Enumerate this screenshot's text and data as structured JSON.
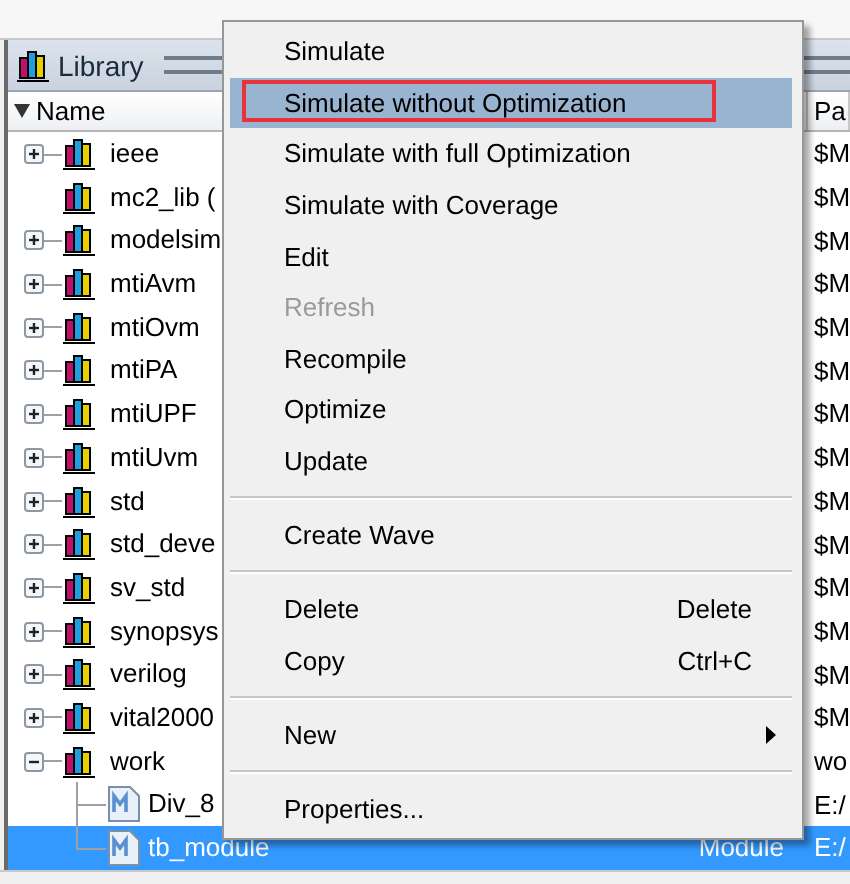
{
  "panel": {
    "title": "Library"
  },
  "columns": [
    {
      "label": "Name"
    },
    {
      "label": "Pa"
    }
  ],
  "libraries": [
    {
      "kind": "library",
      "name": "ieee",
      "expanded": false,
      "selected": false,
      "path": "$M"
    },
    {
      "kind": "library",
      "name": "mc2_lib (",
      "selected": false,
      "path": "$M"
    },
    {
      "kind": "library",
      "name": "modelsim",
      "expanded": false,
      "selected": false,
      "path": "$M"
    },
    {
      "kind": "library",
      "name": "mtiAvm",
      "expanded": false,
      "selected": false,
      "path": "$M"
    },
    {
      "kind": "library",
      "name": "mtiOvm",
      "expanded": false,
      "selected": false,
      "path": "$M"
    },
    {
      "kind": "library",
      "name": "mtiPA",
      "expanded": false,
      "selected": false,
      "path": "$M"
    },
    {
      "kind": "library",
      "name": "mtiUPF",
      "expanded": false,
      "selected": false,
      "path": "$M"
    },
    {
      "kind": "library",
      "name": "mtiUvm",
      "expanded": false,
      "selected": false,
      "path": "$M"
    },
    {
      "kind": "library",
      "name": "std",
      "expanded": false,
      "selected": false,
      "path": "$M"
    },
    {
      "kind": "library",
      "name": "std_deve",
      "expanded": false,
      "selected": false,
      "path": "$M"
    },
    {
      "kind": "library",
      "name": "sv_std",
      "expanded": false,
      "selected": false,
      "path": "$M"
    },
    {
      "kind": "library",
      "name": "synopsys",
      "expanded": false,
      "selected": false,
      "path": "$M"
    },
    {
      "kind": "library",
      "name": "verilog",
      "expanded": false,
      "selected": false,
      "path": "$M"
    },
    {
      "kind": "library",
      "name": "vital2000",
      "expanded": false,
      "selected": false,
      "path": "$M"
    },
    {
      "kind": "library",
      "name": "work",
      "expanded": true,
      "selected": false,
      "path": "wo",
      "children": [
        {
          "kind": "module",
          "name": "Div_8",
          "selected": false,
          "path": "E:/"
        },
        {
          "kind": "module",
          "name": "tb_module",
          "type": "Module",
          "selected": true,
          "path": "E:/"
        }
      ]
    }
  ],
  "context_menu": [
    {
      "kind": "item",
      "label": "Simulate",
      "disabled": false,
      "selected": false
    },
    {
      "kind": "item",
      "label": "Simulate without Optimization",
      "disabled": false,
      "selected": true,
      "outlined": true
    },
    {
      "kind": "item",
      "label": "Simulate with full Optimization",
      "disabled": false,
      "selected": false
    },
    {
      "kind": "item",
      "label": "Simulate with Coverage",
      "disabled": false,
      "selected": false
    },
    {
      "kind": "item",
      "label": "Edit",
      "disabled": false,
      "selected": false
    },
    {
      "kind": "item",
      "label": "Refresh",
      "disabled": true,
      "selected": false
    },
    {
      "kind": "item",
      "label": "Recompile",
      "disabled": false,
      "selected": false
    },
    {
      "kind": "item",
      "label": "Optimize",
      "disabled": false,
      "selected": false
    },
    {
      "kind": "item",
      "label": "Update",
      "disabled": false,
      "selected": false
    },
    {
      "kind": "separator"
    },
    {
      "kind": "item",
      "label": "Create Wave",
      "disabled": false,
      "selected": false
    },
    {
      "kind": "separator"
    },
    {
      "kind": "item",
      "label": "Delete",
      "shortcut": "Delete",
      "disabled": false,
      "selected": false
    },
    {
      "kind": "item",
      "label": "Copy",
      "shortcut": "Ctrl+C",
      "disabled": false,
      "selected": false
    },
    {
      "kind": "separator"
    },
    {
      "kind": "item",
      "label": "New",
      "submenu": true,
      "disabled": false,
      "selected": false
    },
    {
      "kind": "separator"
    },
    {
      "kind": "item",
      "label": "Properties...",
      "disabled": false,
      "selected": false
    }
  ]
}
